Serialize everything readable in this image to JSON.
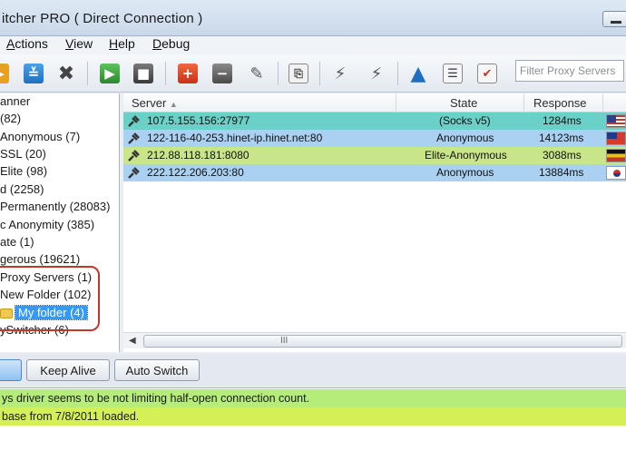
{
  "window": {
    "title": "itcher PRO ( Direct Connection )"
  },
  "menu": [
    {
      "key": "A",
      "rest": "ctions"
    },
    {
      "key": "V",
      "rest": "iew"
    },
    {
      "key": "H",
      "rest": "elp"
    },
    {
      "key": "D",
      "rest": "ebug"
    }
  ],
  "toolbar": {
    "filter_placeholder": "Filter Proxy Servers",
    "icons": [
      "arrow-icon",
      "download-icon",
      "delete-icon",
      "play-icon",
      "stop-icon",
      "add-icon",
      "remove-icon",
      "edit-icon",
      "export-icon",
      "plug-icon",
      "unplug-icon",
      "warning-icon",
      "list-icon",
      "checklist-icon"
    ]
  },
  "tree": {
    "items": [
      "anner",
      " (82)",
      " Anonymous (7)",
      " SSL (20)",
      "Elite (98)",
      "d (2258)",
      " Permanently (28083)",
      "c Anonymity (385)",
      "ate (1)",
      "gerous (19621)",
      "Proxy Servers (1)",
      "New Folder (102)",
      "My folder (4)",
      "ySwitcher (6)"
    ]
  },
  "grid": {
    "columns": {
      "server": "Server",
      "state": "State",
      "response": "Response"
    },
    "rows": [
      {
        "server": "107.5.155.156:27977",
        "state": "(Socks v5)",
        "response": "1284ms",
        "color": "#6ad1c8"
      },
      {
        "server": "122-116-40-253.hinet-ip.hinet.net:80",
        "state": "Anonymous",
        "response": "14123ms",
        "color": "#aad0f2"
      },
      {
        "server": "212.88.118.181:8080",
        "state": "Elite-Anonymous",
        "response": "3088ms",
        "color": "#c9e58a"
      },
      {
        "server": "222.122.206.203:80",
        "state": "Anonymous",
        "response": "13884ms",
        "color": "#aad0f2"
      }
    ],
    "scroll_grip": "III"
  },
  "buttons": {
    "keep_alive": "Keep Alive",
    "auto_switch": "Auto Switch"
  },
  "log": [
    {
      "text": "ys driver seems to be not limiting half-open connection count.",
      "color": "#b5ec7a"
    },
    {
      "text": "base from 7/8/2011 loaded.",
      "color": "#d5ef57"
    }
  ]
}
